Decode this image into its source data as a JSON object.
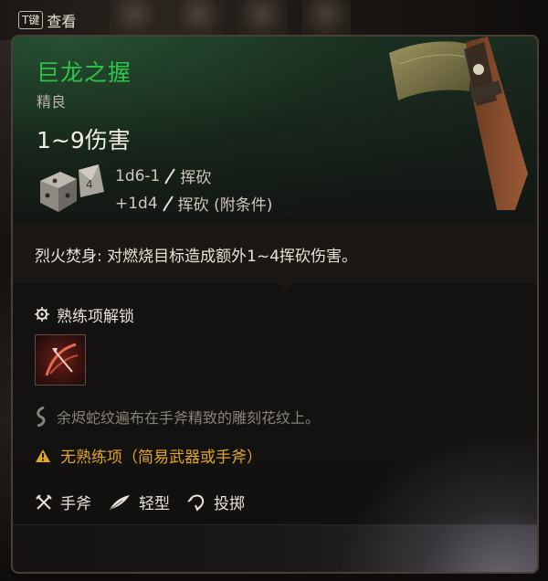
{
  "top_hint": {
    "key": "T键",
    "label": "查看"
  },
  "item": {
    "name": "巨龙之握",
    "rarity": "精良",
    "damage_range": "1~9伤害",
    "damage_lines": [
      {
        "dice": "1d6-1",
        "type": "挥砍"
      },
      {
        "dice": "+1d4",
        "type": "挥砍 (附条件)"
      }
    ],
    "passive": "烈火焚身: 对燃烧目标造成额外1~4挥砍伤害。",
    "proficiency_unlock_label": "熟练项解锁",
    "flavor": "余烬蛇纹遍布在手斧精致的雕刻花纹上。",
    "warning": "无熟练项（简易武器或手斧）",
    "properties": [
      {
        "label": "手斧",
        "icon": "crossed-weapons-icon"
      },
      {
        "label": "轻型",
        "icon": "feather-icon"
      },
      {
        "label": "投掷",
        "icon": "throw-arrow-icon"
      }
    ]
  },
  "colors": {
    "title_green": "#2ec44a",
    "warning_amber": "#e0a526",
    "text": "#e9e2d6",
    "muted": "#8a8278"
  }
}
